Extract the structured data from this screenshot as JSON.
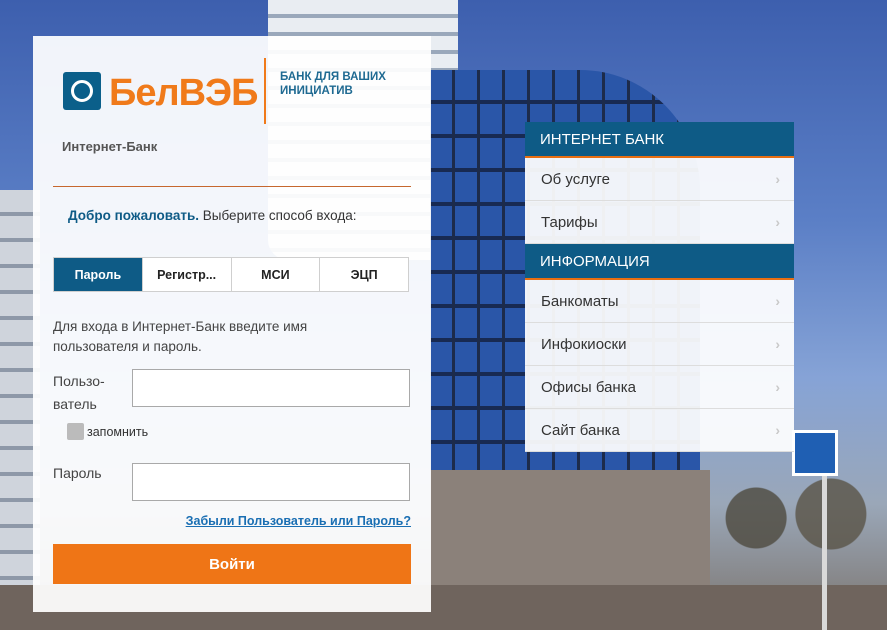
{
  "brand": {
    "logo_text": "БелВЭБ",
    "slogan": "БАНК ДЛЯ ВАШИХ ИНИЦИАТИВ"
  },
  "login": {
    "title": "Интернет-Банк",
    "welcome_bold": "Добро пожаловать.",
    "welcome_rest": " Выберите способ входа:",
    "tabs": [
      {
        "label": "Пароль",
        "active": true
      },
      {
        "label": "Регистр..."
      },
      {
        "label": "МСИ"
      },
      {
        "label": "ЭЦП"
      }
    ],
    "hint": "Для входа в Интернет-Банк введите имя пользователя и пароль.",
    "username_label_1": "Пользо-",
    "username_label_2": "ватель",
    "username_value": "",
    "remember_label": "запомнить",
    "password_label": "Пароль",
    "password_value": "",
    "forgot_link": "Забыли Пользователь или Пароль?",
    "submit_label": "Войти"
  },
  "menu": {
    "sections": [
      {
        "header": "ИНТЕРНЕТ БАНК",
        "items": [
          "Об услуге",
          "Тарифы"
        ]
      },
      {
        "header": "ИНФОРМАЦИЯ",
        "items": [
          "Банкоматы",
          "Инфокиоски",
          "Офисы банка",
          "Сайт банка"
        ]
      }
    ],
    "chevron": "›"
  },
  "colors": {
    "accent_orange": "#ef7516",
    "brand_blue": "#0e5b86"
  }
}
